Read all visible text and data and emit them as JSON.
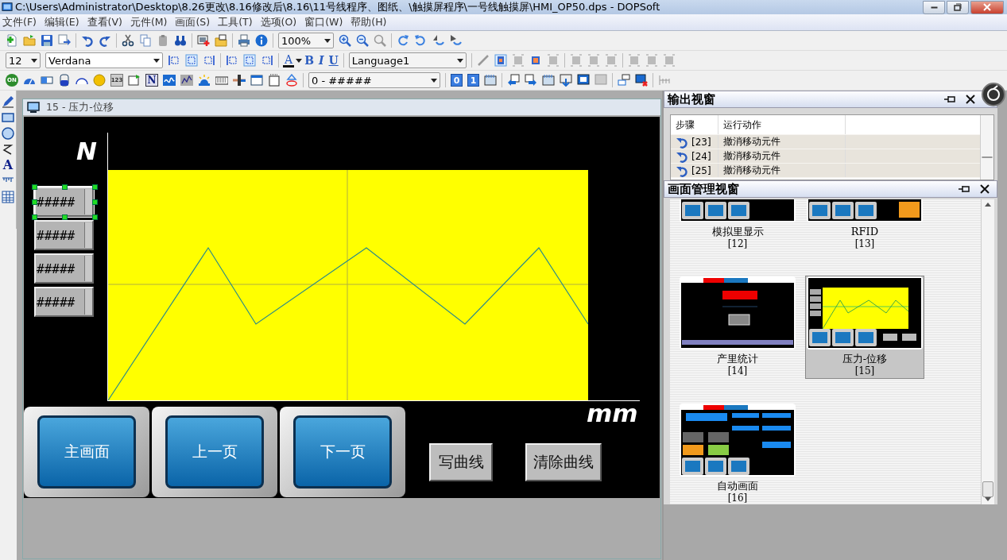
{
  "window": {
    "title": "C:\\Users\\Administrator\\Desktop\\8.26更改\\8.16修改后\\8.16\\11号线程序、图纸、\\触摸屏程序\\一号线触摸屏\\HMI_OP50.dps - DOPSoft"
  },
  "menu": [
    {
      "label": "文件(F)"
    },
    {
      "label": "编辑(E)"
    },
    {
      "label": "查看(V)"
    },
    {
      "label": "元件(M)"
    },
    {
      "label": "画面(S)"
    },
    {
      "label": "工具(T)"
    },
    {
      "label": "选项(O)"
    },
    {
      "label": "窗口(W)"
    },
    {
      "label": "帮助(H)"
    }
  ],
  "toolbar_main": {
    "zoom": "100%"
  },
  "toolbar_text": {
    "font_size": "12",
    "font": "Verdana",
    "font_color": "A",
    "bold": "B",
    "italic": "I",
    "underline": "U",
    "language": "Language1"
  },
  "toolbar_elements": {
    "on_lamp": "ON",
    "numeric": "123",
    "n_button": "N",
    "format": "0 - #####",
    "zero": "0",
    "one": "1"
  },
  "toolbox": {
    "text_tool": "A"
  },
  "document": {
    "title": "15 - 压力-位移",
    "y_label": "N",
    "x_label": "mm",
    "numeric_fields": [
      {
        "text": "#####",
        "selected": true
      },
      {
        "text": "#####",
        "selected": false
      },
      {
        "text": "#####",
        "selected": false
      },
      {
        "text": "#####",
        "selected": false
      }
    ],
    "nav_buttons": [
      "主画面",
      "上一页",
      "下一页"
    ],
    "action_buttons": [
      "写曲线",
      "清除曲线"
    ]
  },
  "output_panel": {
    "title": "输出视窗",
    "columns": [
      "步骤",
      "运行动作"
    ],
    "rows": [
      {
        "step": "[23]",
        "action": "撤消移动元件"
      },
      {
        "step": "[24]",
        "action": "撤消移动元件"
      },
      {
        "step": "[25]",
        "action": "撤消移动元件"
      }
    ]
  },
  "screen_manager": {
    "title": "画面管理视窗",
    "screens": [
      {
        "name": "模拟里显示",
        "number": "[12]",
        "kind": "nav",
        "selected": false
      },
      {
        "name": "RFID",
        "number": "[13]",
        "kind": "nav_alarm",
        "selected": false
      },
      {
        "name": "产里统计",
        "number": "[14]",
        "kind": "count",
        "selected": false
      },
      {
        "name": "压力-位移",
        "number": "[15]",
        "kind": "curve",
        "selected": true
      },
      {
        "name": "自动画面",
        "number": "[16]",
        "kind": "auto",
        "selected": false
      }
    ]
  }
}
